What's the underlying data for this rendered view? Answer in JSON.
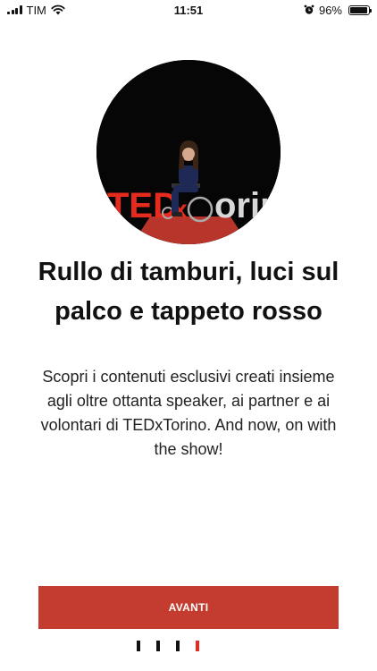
{
  "status_bar": {
    "carrier": "TIM",
    "time": "11:51",
    "battery_percent": "96%",
    "battery_level": 0.96,
    "icons": [
      "signal-icon",
      "wifi-icon",
      "alarm-icon",
      "battery-icon"
    ]
  },
  "hero": {
    "image_description_icon": "speaker-on-stage-image"
  },
  "content": {
    "title": "Rullo di tamburi, luci sul palco e tappeto rosso",
    "description": "Scopri i contenuti esclusivi creati insieme agli oltre ottanta speaker, ai partner e ai volontari di TEDxTorino. And now, on with the show!"
  },
  "actions": {
    "next_label": "AVANTI"
  },
  "pager": {
    "total": 4,
    "active_index": 3
  },
  "colors": {
    "accent": "#c43c30",
    "ted_red": "#e62b1e"
  }
}
